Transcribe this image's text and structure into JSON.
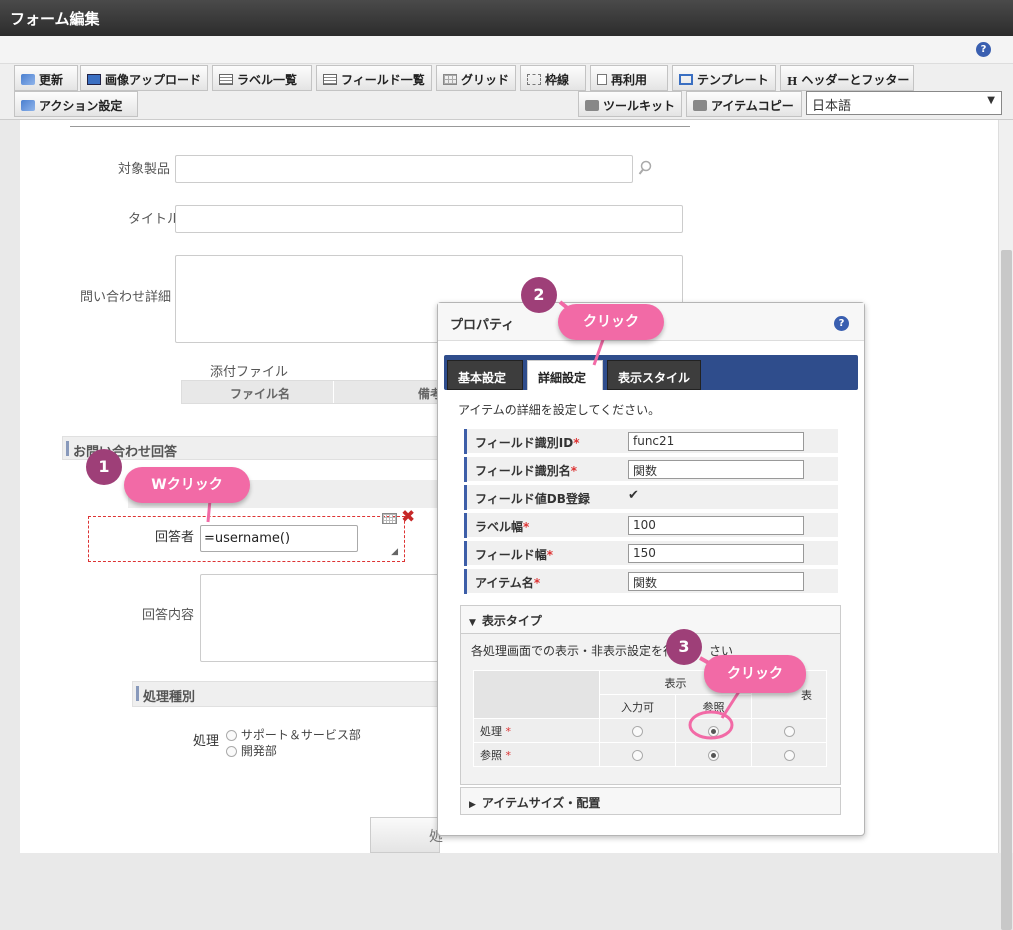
{
  "window": {
    "title": "フォーム編集"
  },
  "toolbar": {
    "row1": [
      {
        "label": "更新",
        "icon": "refresh-icon"
      },
      {
        "label": "画像アップロード",
        "icon": "image-upload-icon"
      },
      {
        "label": "ラベル一覧",
        "icon": "list-icon"
      },
      {
        "label": "フィールド一覧",
        "icon": "list-icon"
      },
      {
        "label": "グリッド",
        "icon": "grid-icon"
      },
      {
        "label": "枠線",
        "icon": "border-icon"
      },
      {
        "label": "再利用",
        "icon": "document-icon"
      },
      {
        "label": "テンプレート",
        "icon": "template-icon"
      },
      {
        "label": "ヘッダーとフッター",
        "icon": "header-icon"
      }
    ],
    "row2_left": {
      "label": "アクション設定",
      "icon": "action-icon"
    },
    "row2_right": [
      {
        "label": "ツールキット",
        "icon": "toolbox-icon"
      },
      {
        "label": "アイテムコピー",
        "icon": "toolbox-icon"
      }
    ],
    "language": "日本語",
    "help": "?"
  },
  "form": {
    "product_label": "対象製品",
    "title_label": "タイトル",
    "detail_label": "問い合わせ詳細",
    "attachment_label": "添付ファイル",
    "attachment_columns": [
      "ファイル名",
      "備考"
    ],
    "answer_section": "お問い合わせ回答",
    "responder_label": "回答者",
    "responder_value": "=username()",
    "answer_content_label": "回答内容",
    "process_section": "処理種別",
    "process_label": "処理",
    "process_options": [
      "サポート＆サービス部",
      "開発部"
    ],
    "bottom_button": "処"
  },
  "dialog": {
    "title": "プロパティ",
    "help": "?",
    "tabs": [
      "基本設定",
      "詳細設定",
      "表示スタイル"
    ],
    "description": "アイテムの詳細を設定してください。",
    "rows": [
      {
        "key": "フィールド識別ID",
        "required": "*",
        "value": "func21"
      },
      {
        "key": "フィールド識別名",
        "required": "*",
        "value": "関数"
      },
      {
        "key": "フィールド値DB登録",
        "required": "",
        "value": "✔"
      },
      {
        "key": "ラベル幅",
        "required": "*",
        "value": "100"
      },
      {
        "key": "フィールド幅",
        "required": "*",
        "value": "150"
      },
      {
        "key": "アイテム名",
        "required": "*",
        "value": "関数"
      }
    ],
    "display_type": {
      "header": "表示タイプ",
      "description": "各処理画面での表示・非表示設定を行",
      "description_tail": "さい",
      "group_header": "表示",
      "hidden_header": "表",
      "columns": [
        "入力可",
        "参照"
      ],
      "rows": [
        {
          "label": "処理",
          "required": "*"
        },
        {
          "label": "参照",
          "required": "*"
        }
      ]
    },
    "size_section": "アイテムサイズ・配置"
  },
  "annotations": [
    {
      "num": "1",
      "text": "Wクリック"
    },
    {
      "num": "2",
      "text": "クリック"
    },
    {
      "num": "3",
      "text": "クリック"
    }
  ],
  "colors": {
    "accent": "#f26aa6",
    "badge": "#9e3f78",
    "tabbar": "#2f4d8c"
  }
}
